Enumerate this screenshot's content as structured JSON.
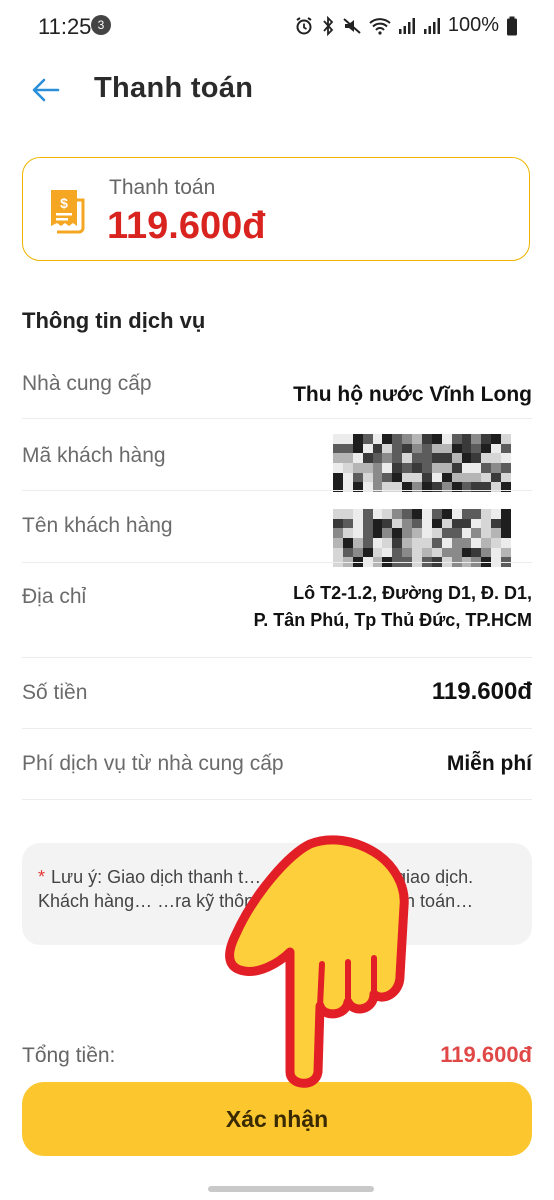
{
  "status_bar": {
    "time": "11:25",
    "notification_count": "3",
    "battery": "100%"
  },
  "header": {
    "back_icon": "arrow-left-icon",
    "title": "Thanh toán"
  },
  "payment_card": {
    "icon": "receipt-icon",
    "label": "Thanh toán",
    "amount": "119.600đ"
  },
  "service_info": {
    "title": "Thông tin dịch vụ",
    "provider_label": "Nhà cung cấp",
    "provider_value": "Thu hộ nước Vĩnh Long",
    "customer_code_label": "Mã khách hàng",
    "customer_name_label": "Tên khách hàng",
    "address_label": "Địa chỉ",
    "address_line1": "Lô T2-1.2, Đường D1, Đ. D1,",
    "address_line2": "P. Tân Phú, Tp Thủ Đức, TP.HCM",
    "amount_label": "Số tiền",
    "amount_value": "119.600đ",
    "fee_label": "Phí dịch vụ từ nhà cung cấp",
    "fee_value": "Miễn phí"
  },
  "note": {
    "star": "*",
    "text": "Lưu ý: Giao dịch thanh t… …ng hỗ trợ hủy giao dịch. Khách hàng… …ra kỹ thông tin trước khi thanh toán…"
  },
  "footer": {
    "total_label": "Tổng tiền:",
    "total_value": "119.600đ",
    "confirm_label": "Xác nhận"
  },
  "colors": {
    "accent_yellow": "#fcc72e",
    "amount_red": "#d8231e",
    "total_red": "#e04848",
    "back_arrow_blue": "#2a8fd8",
    "card_border": "#f0b400"
  }
}
